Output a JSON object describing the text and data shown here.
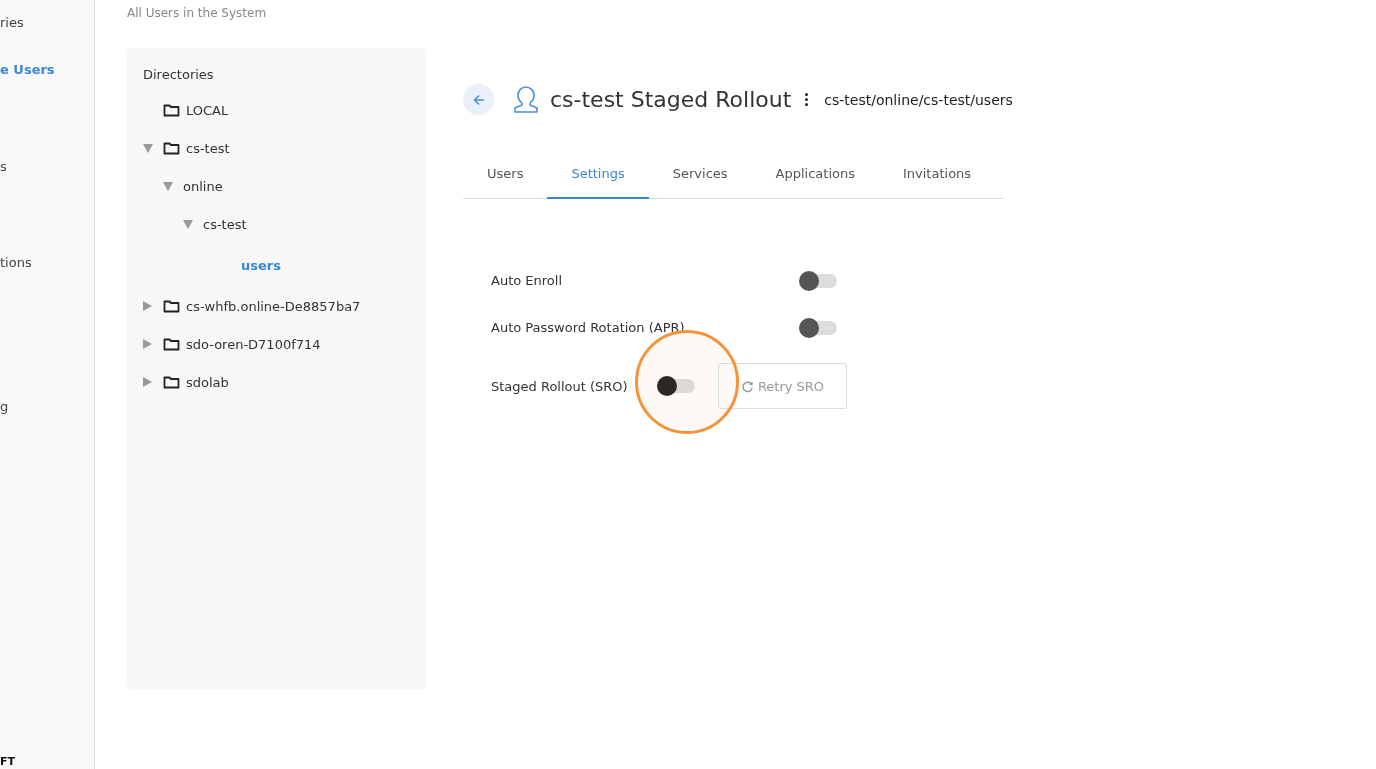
{
  "sidebar": {
    "items": [
      {
        "label": "ries",
        "selected": false
      },
      {
        "label": "e Users",
        "selected": true
      },
      {
        "label": "s",
        "selected": false
      },
      {
        "label": "tions",
        "selected": false
      },
      {
        "label": "g",
        "selected": false
      }
    ],
    "footer": "FT"
  },
  "page_subtitle": "All Users in the System",
  "directories": {
    "title": "Directories",
    "tree": [
      {
        "label": "LOCAL",
        "folder": true,
        "selected": false
      },
      {
        "label": "cs-test",
        "folder": true,
        "expanded": true,
        "selected": false,
        "children": [
          {
            "label": "online",
            "folder": false,
            "expanded": true,
            "selected": false,
            "children": [
              {
                "label": "cs-test",
                "folder": false,
                "expanded": true,
                "selected": false,
                "children": [
                  {
                    "label": "users",
                    "folder": false,
                    "selected": true
                  }
                ]
              }
            ]
          }
        ]
      },
      {
        "label": "cs-whfb.online-De8857ba7",
        "folder": true,
        "expanded": false,
        "selected": false
      },
      {
        "label": "sdo-oren-D7100f714",
        "folder": true,
        "expanded": false,
        "selected": false
      },
      {
        "label": "sdolab",
        "folder": true,
        "expanded": false,
        "selected": false
      }
    ]
  },
  "header": {
    "title": "cs-test Staged Rollout",
    "path": "cs-test/online/cs-test/users"
  },
  "tabs": [
    {
      "label": "Users",
      "selected": false
    },
    {
      "label": "Settings",
      "selected": true
    },
    {
      "label": "Services",
      "selected": false
    },
    {
      "label": "Applications",
      "selected": false
    },
    {
      "label": "Invitations",
      "selected": false
    }
  ],
  "settings": [
    {
      "label": "Auto Enroll",
      "on": false,
      "highlighted": false
    },
    {
      "label": "Auto Password Rotation (APR)",
      "on": false,
      "highlighted": false
    },
    {
      "label": "Staged Rollout (SRO)",
      "on": false,
      "highlighted": true,
      "action": {
        "label": "Retry SRO",
        "disabled": true
      }
    }
  ]
}
